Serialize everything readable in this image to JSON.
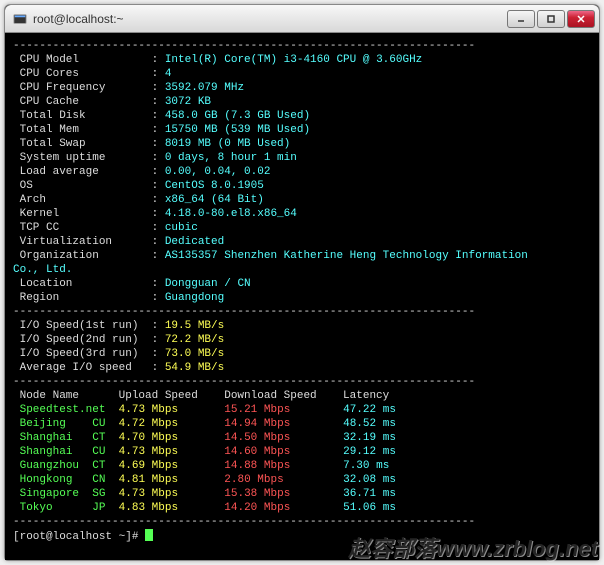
{
  "window": {
    "title": "root@localhost:~"
  },
  "divider": "----------------------------------------------------------------------",
  "sysinfo": [
    {
      "label": "CPU Model",
      "value": "Intel(R) Core(TM) i3-4160 CPU @ 3.60GHz"
    },
    {
      "label": "CPU Cores",
      "value": "4"
    },
    {
      "label": "CPU Frequency",
      "value": "3592.079 MHz"
    },
    {
      "label": "CPU Cache",
      "value": "3072 KB"
    },
    {
      "label": "Total Disk",
      "value": "458.0 GB (7.3 GB Used)"
    },
    {
      "label": "Total Mem",
      "value": "15750 MB (539 MB Used)"
    },
    {
      "label": "Total Swap",
      "value": "8019 MB (0 MB Used)"
    },
    {
      "label": "System uptime",
      "value": "0 days, 8 hour 1 min"
    },
    {
      "label": "Load average",
      "value": "0.00, 0.04, 0.02"
    },
    {
      "label": "OS",
      "value": "CentOS 8.0.1905"
    },
    {
      "label": "Arch",
      "value": "x86_64 (64 Bit)"
    },
    {
      "label": "Kernel",
      "value": "4.18.0-80.el8.x86_64"
    },
    {
      "label": "TCP CC",
      "value": "cubic"
    },
    {
      "label": "Virtualization",
      "value": "Dedicated"
    }
  ],
  "org": {
    "label": "Organization",
    "line1": "AS135357 Shenzhen Katherine Heng Technology Information",
    "line2": "Co., Ltd."
  },
  "location": {
    "label": "Location",
    "value": "Dongguan / CN"
  },
  "region": {
    "label": "Region",
    "value": "Guangdong"
  },
  "io": [
    {
      "label": "I/O Speed(1st run)",
      "value": "19.5 MB/s"
    },
    {
      "label": "I/O Speed(2nd run)",
      "value": "72.2 MB/s"
    },
    {
      "label": "I/O Speed(3rd run)",
      "value": "73.0 MB/s"
    },
    {
      "label": "Average I/O speed",
      "value": "54.9 MB/s"
    }
  ],
  "speed_header": {
    "node": "Node Name",
    "upload": "Upload Speed",
    "download": "Download Speed",
    "latency": "Latency"
  },
  "speed": [
    {
      "node": "Speedtest.net",
      "up": "4.73 Mbps",
      "down": "15.21 Mbps",
      "lat": "47.22 ms",
      "dcolor": "red"
    },
    {
      "node": "Beijing    CU",
      "up": "4.72 Mbps",
      "down": "14.94 Mbps",
      "lat": "48.52 ms",
      "dcolor": "red"
    },
    {
      "node": "Shanghai   CT",
      "up": "4.70 Mbps",
      "down": "14.50 Mbps",
      "lat": "32.19 ms",
      "dcolor": "red"
    },
    {
      "node": "Shanghai   CU",
      "up": "4.73 Mbps",
      "down": "14.60 Mbps",
      "lat": "29.12 ms",
      "dcolor": "red"
    },
    {
      "node": "Guangzhou  CT",
      "up": "4.69 Mbps",
      "down": "14.88 Mbps",
      "lat": "7.30 ms",
      "dcolor": "red"
    },
    {
      "node": "Hongkong   CN",
      "up": "4.81 Mbps",
      "down": "2.80 Mbps",
      "lat": "32.08 ms",
      "dcolor": "red"
    },
    {
      "node": "Singapore  SG",
      "up": "4.73 Mbps",
      "down": "15.38 Mbps",
      "lat": "36.71 ms",
      "dcolor": "red"
    },
    {
      "node": "Tokyo      JP",
      "up": "4.83 Mbps",
      "down": "14.20 Mbps",
      "lat": "51.06 ms",
      "dcolor": "red"
    }
  ],
  "prompt": "[root@localhost ~]# ",
  "watermark": "赵容部落www.zrblog.net"
}
